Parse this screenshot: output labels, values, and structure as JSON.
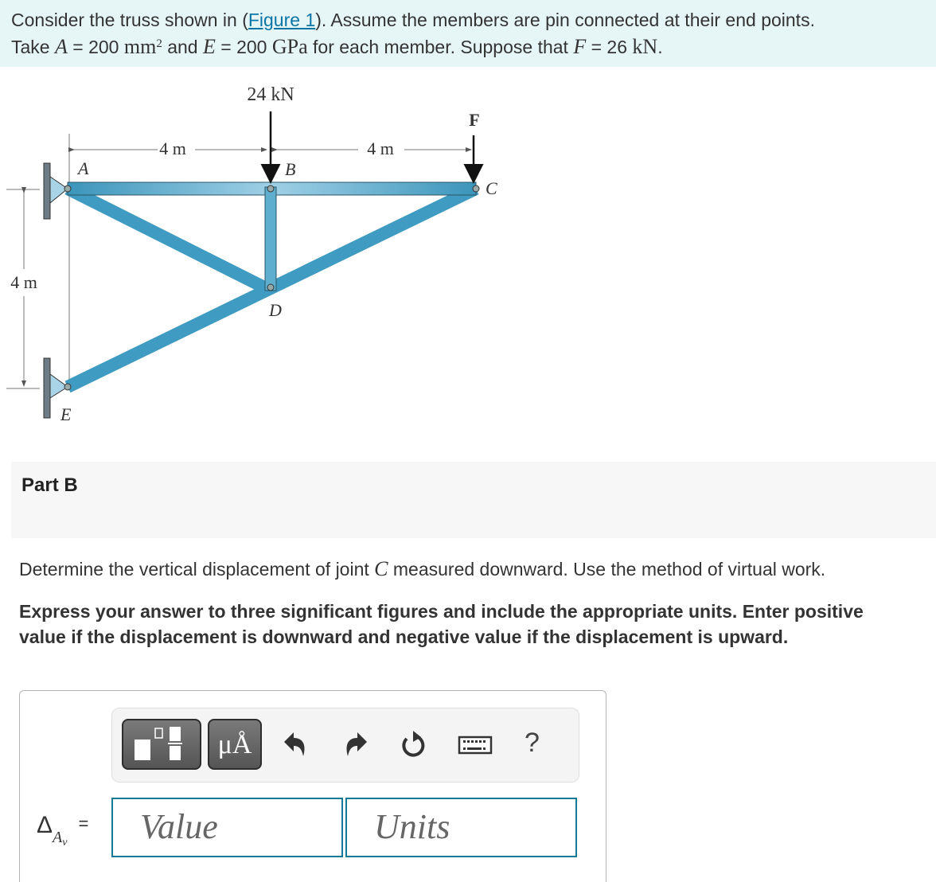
{
  "intro": {
    "line1_pre": "Consider the truss shown in (",
    "figure_link": "Figure 1",
    "line1_post": "). Assume the members are pin connected at their end points.",
    "line2_take": "Take ",
    "var_A": "A",
    "eq1": " = 200 ",
    "unit_mm": "mm",
    "exp2": "2",
    "and": " and ",
    "var_E": "E",
    "eq2": " = 200 ",
    "unit_GPa": "GPa",
    "for_each": " for each member. Suppose that ",
    "var_F": "F",
    "eq3": " = 26 ",
    "unit_kN": "kN",
    "period": "."
  },
  "figure": {
    "load_B": "24 kN",
    "load_C": "F",
    "dim_AB": "4 m",
    "dim_BC": "4 m",
    "dim_AE": "4 m",
    "joints": {
      "A": "A",
      "B": "B",
      "C": "C",
      "D": "D",
      "E": "E"
    },
    "member_color": "#4aa3c6"
  },
  "part": {
    "label": "Part B"
  },
  "question": {
    "pre": "Determine the vertical displacement of joint ",
    "var": "C",
    "post": " measured downward. Use the method of virtual work."
  },
  "instructions": "Express your answer to three significant figures and include the appropriate units. Enter positive value if the displacement is downward and negative value if the displacement is upward.",
  "toolbar": {
    "units_button": "μÅ",
    "help": "?",
    "icons": [
      "templates-icon",
      "units-icon",
      "undo-icon",
      "redo-icon",
      "reset-icon",
      "keyboard-icon",
      "help-icon"
    ]
  },
  "answer": {
    "symbol": "Δ",
    "subscript": "A",
    "subsubscript": "v",
    "equals": "=",
    "value_placeholder": "Value",
    "units_placeholder": "Units"
  },
  "colors": {
    "accent": "#137a95",
    "link": "#0a75a6",
    "intro_bg": "#e6f6f7"
  }
}
